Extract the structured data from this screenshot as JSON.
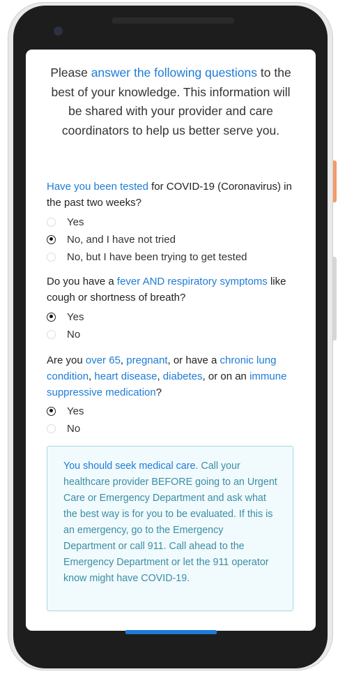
{
  "intro": {
    "pre": "Please ",
    "link": "answer the following questions",
    "post": " to the best of your knowledge. This information will be shared with your provider and care coordinators to help us better serve you."
  },
  "q1": {
    "link": "Have you been tested",
    "rest": " for COVID-19 (Coronavirus) in the past two weeks?",
    "options": [
      {
        "label": "Yes",
        "selected": false
      },
      {
        "label": "No, and I have not tried",
        "selected": true
      },
      {
        "label": "No, but I have been trying to get tested",
        "selected": false
      }
    ]
  },
  "q2": {
    "pre": "Do you have a ",
    "link": "fever AND respiratory symptoms",
    "rest": " like cough or shortness of breath?",
    "options": [
      {
        "label": "Yes",
        "selected": true
      },
      {
        "label": "No",
        "selected": false
      }
    ]
  },
  "q3": {
    "pre": "Are you ",
    "link1": "over 65",
    "sep1": ", ",
    "link2": "pregnant",
    "sep2": ", or have a ",
    "link3": "chronic lung condition",
    "sep3": ", ",
    "link4": "heart disease",
    "sep4": ", ",
    "link5": "diabetes",
    "sep5": ", or on an ",
    "link6": "immune suppressive medication",
    "end": "?",
    "options": [
      {
        "label": "Yes",
        "selected": true
      },
      {
        "label": "No",
        "selected": false
      }
    ]
  },
  "result": {
    "lead": "You should seek medical care",
    "body": ". Call your healthcare provider BEFORE going to an Urgent Care or Emergency Department and ask what the best way is for you to be evaluated. If this is an emergency, go to the Emergency Department or call 911. Call ahead to the Emergency Department or let the 911 operator know might have COVID-19."
  },
  "colors": {
    "accent": "#1e7bd6",
    "result_text": "#3a8ea4",
    "result_bg": "#f1fafd",
    "result_border": "#a8d8e4"
  }
}
